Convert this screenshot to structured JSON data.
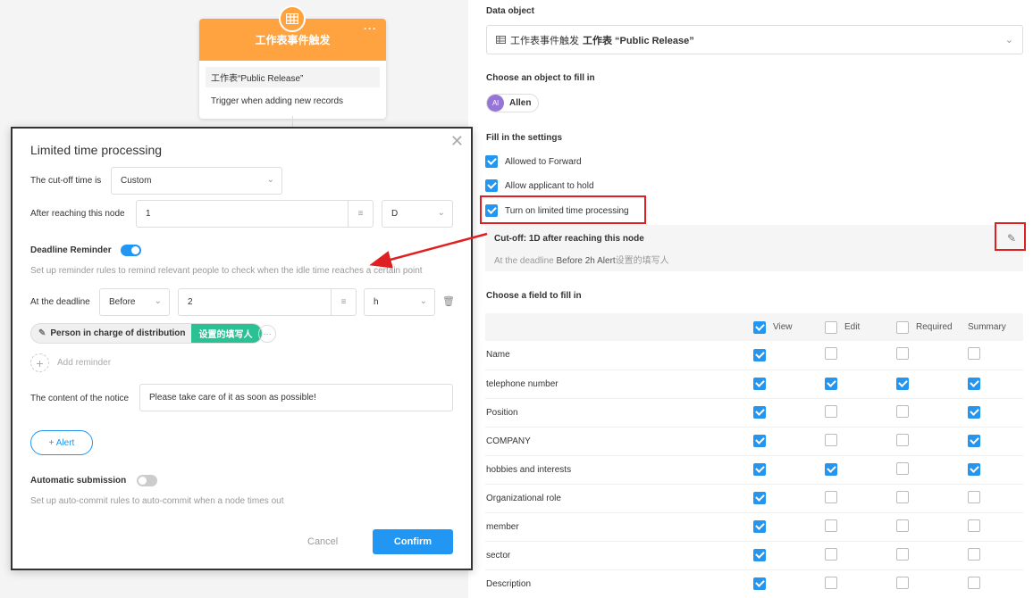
{
  "flow": {
    "node_title": "工作表事件触发",
    "node_sheet": "工作表“Public Release”",
    "node_desc": "Trigger when adding new records"
  },
  "panel": {
    "data_object_label": "Data object",
    "data_object_prefix": "工作表事件触发",
    "data_object_value": "工作表 “Public Release”",
    "fill_object_label": "Choose an object to fill in",
    "user_initials": "Al",
    "user_name": "Allen",
    "settings_label": "Fill in the settings",
    "settings": [
      {
        "label": "Allowed to Forward",
        "checked": true
      },
      {
        "label": "Allow applicant to hold",
        "checked": true
      },
      {
        "label": "Turn on limited time processing",
        "checked": true
      }
    ],
    "cutoff_title": "Cut-off: 1D after reaching this node",
    "cutoff_sub_prefix": "At the deadline",
    "cutoff_sub_before": "Before",
    "cutoff_sub_value": "2h",
    "cutoff_sub_alert": "Alert",
    "cutoff_sub_target": "设置的填写人",
    "fields_label": "Choose a field to fill in",
    "columns": [
      "View",
      "Edit",
      "Required",
      "Summary"
    ],
    "rows": [
      {
        "name": "Name",
        "view": true,
        "edit": false,
        "required": false,
        "summary": false
      },
      {
        "name": "telephone number",
        "view": true,
        "edit": true,
        "required": true,
        "summary": true
      },
      {
        "name": "Position",
        "view": true,
        "edit": false,
        "required": false,
        "summary": true
      },
      {
        "name": "COMPANY",
        "view": true,
        "edit": false,
        "required": false,
        "summary": true
      },
      {
        "name": "hobbies and interests",
        "view": true,
        "edit": true,
        "required": false,
        "summary": true
      },
      {
        "name": "Organizational role",
        "view": true,
        "edit": false,
        "required": false,
        "summary": false
      },
      {
        "name": "member",
        "view": true,
        "edit": false,
        "required": false,
        "summary": false
      },
      {
        "name": "sector",
        "view": true,
        "edit": false,
        "required": false,
        "summary": false
      },
      {
        "name": "Description",
        "view": true,
        "edit": false,
        "required": false,
        "summary": false
      }
    ]
  },
  "modal": {
    "title": "Limited time processing",
    "cutoff_label": "The cut-off time is",
    "cutoff_value": "Custom",
    "after_label": "After reaching this node",
    "after_value": "1",
    "after_unit": "D",
    "reminder_label": "Deadline Reminder",
    "reminder_on": true,
    "reminder_hint": "Set up reminder rules to remind relevant people to check when the idle time reaches a certain point",
    "deadline_label": "At the deadline",
    "deadline_when": "Before",
    "deadline_value": "2",
    "deadline_unit": "h",
    "person_label": "Person in charge of distribution",
    "person_tag": "设置的填写人",
    "add_reminder": "Add reminder",
    "notice_label": "The content of the notice",
    "notice_value": "Please take care of it as soon as possible!",
    "alert_button": "+ Alert",
    "auto_label": "Automatic submission",
    "auto_on": false,
    "auto_hint": "Set up auto-commit rules to auto-commit when a node times out",
    "cancel": "Cancel",
    "confirm": "Confirm"
  },
  "colors": {
    "accent": "#2196f3",
    "node_orange": "#ffa340",
    "tag_green": "#2cc195",
    "annotation_red": "#e02020"
  }
}
